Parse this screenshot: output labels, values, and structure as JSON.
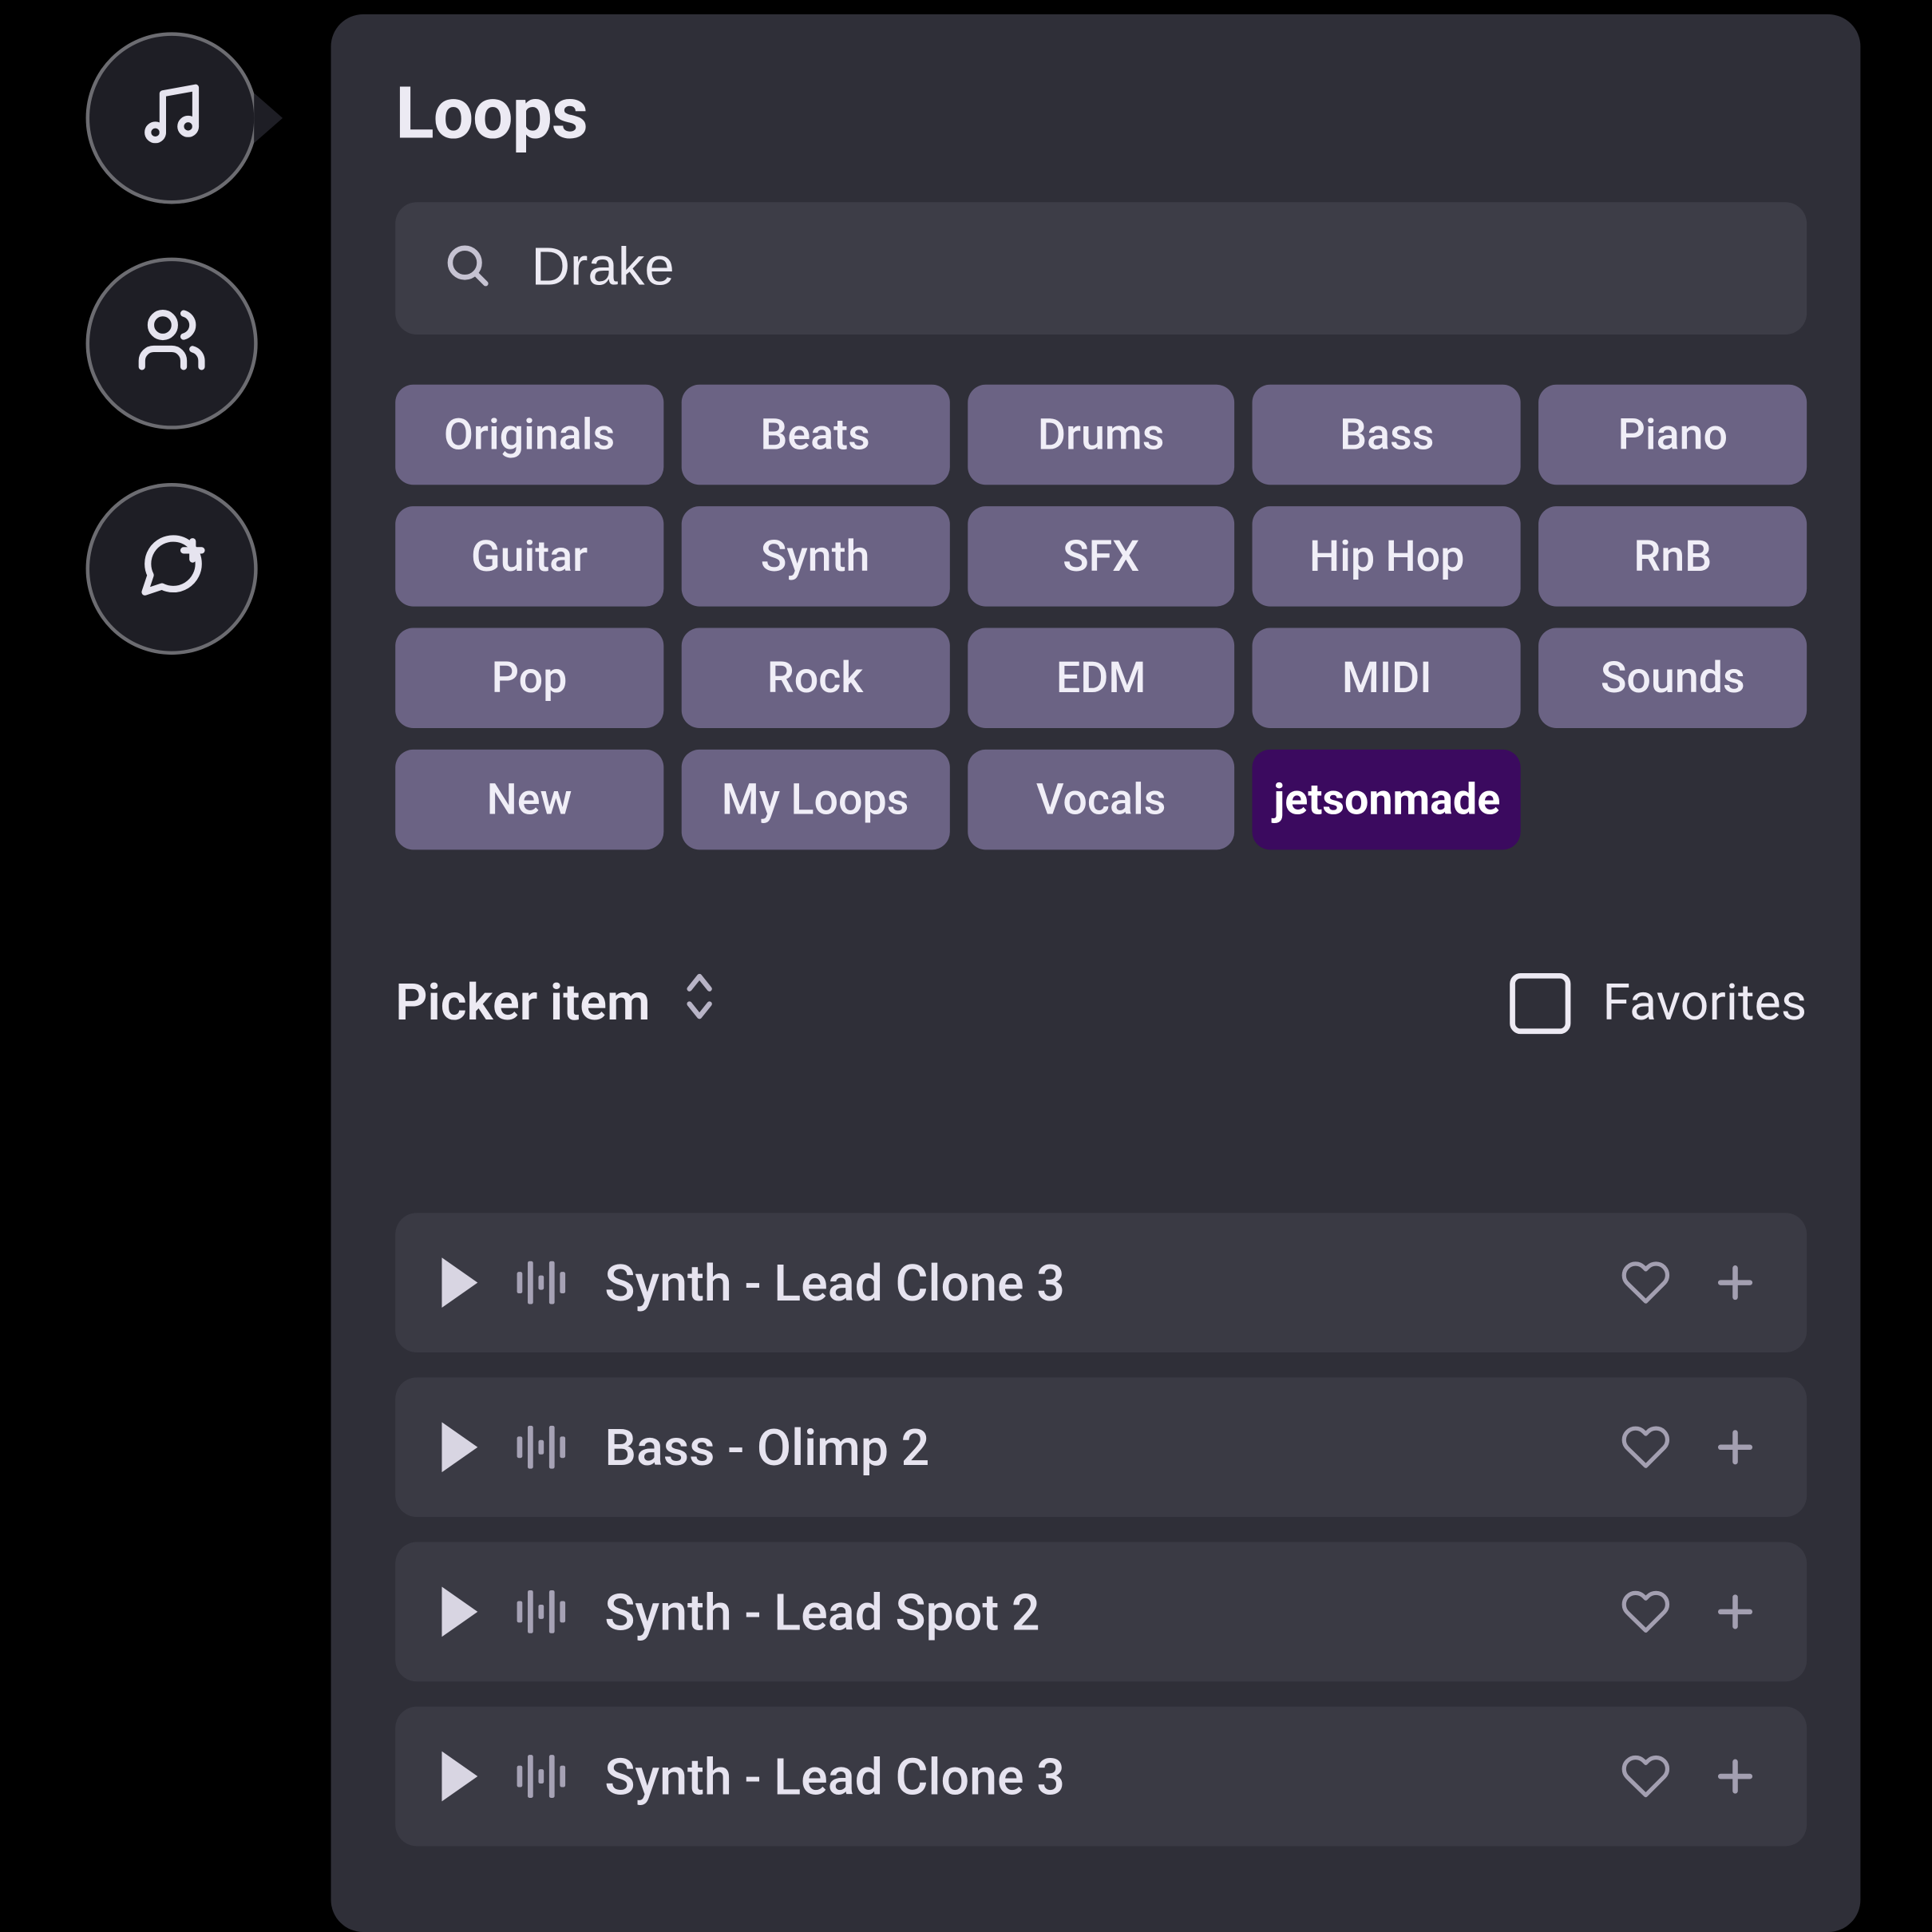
{
  "sidebar": {
    "active_index": 0,
    "items": [
      {
        "icon": "music-note-icon"
      },
      {
        "icon": "people-icon"
      },
      {
        "icon": "chat-add-icon"
      }
    ]
  },
  "panel": {
    "title": "Loops"
  },
  "search": {
    "value": "Drake",
    "placeholder": ""
  },
  "tags": [
    {
      "label": "Originals",
      "selected": false
    },
    {
      "label": "Beats",
      "selected": false
    },
    {
      "label": "Drums",
      "selected": false
    },
    {
      "label": "Bass",
      "selected": false
    },
    {
      "label": "Piano",
      "selected": false
    },
    {
      "label": "Guitar",
      "selected": false
    },
    {
      "label": "Synth",
      "selected": false
    },
    {
      "label": "SFX",
      "selected": false
    },
    {
      "label": "Hip Hop",
      "selected": false
    },
    {
      "label": "RnB",
      "selected": false
    },
    {
      "label": "Pop",
      "selected": false
    },
    {
      "label": "Rock",
      "selected": false
    },
    {
      "label": "EDM",
      "selected": false
    },
    {
      "label": "MIDI",
      "selected": false
    },
    {
      "label": "Sounds",
      "selected": false
    },
    {
      "label": "New",
      "selected": false
    },
    {
      "label": "My Loops",
      "selected": false
    },
    {
      "label": "Vocals",
      "selected": false
    },
    {
      "label": "jetsonmade",
      "selected": true
    }
  ],
  "picker": {
    "label": "Picker item"
  },
  "favorites": {
    "label": "Favorites",
    "checked": false
  },
  "tracks": [
    {
      "title": "Synth - Lead Clone 3"
    },
    {
      "title": "Bass - Olimp 2"
    },
    {
      "title": "Synth - Lead Spot 2"
    },
    {
      "title": "Synth - Lead Clone 3"
    }
  ],
  "colors": {
    "panel_bg": "#2f2f38",
    "row_bg": "#3a3a44",
    "search_bg": "#3d3d47",
    "tag_bg": "#6b6384",
    "tag_selected_bg": "#3b0a5f",
    "sidebutton_bg": "#1e1e25"
  }
}
